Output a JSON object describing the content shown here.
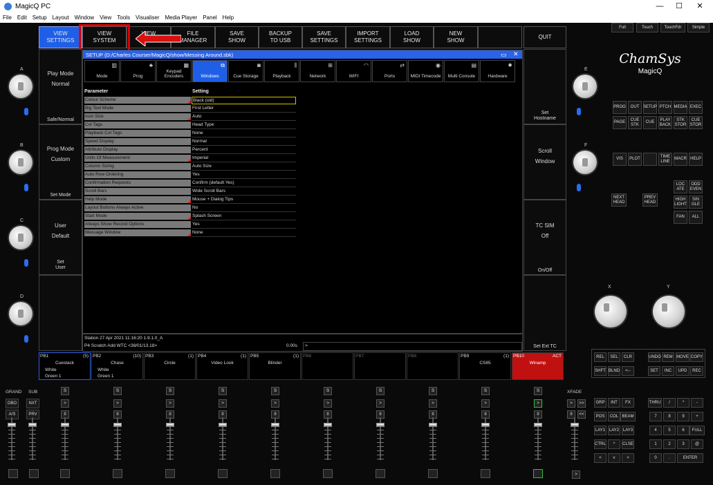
{
  "window": {
    "title": "MagicQ PC",
    "minimize": "—",
    "maximize": "☐",
    "close": "✕"
  },
  "menu": [
    "File",
    "Edit",
    "Setup",
    "Layout",
    "Window",
    "View",
    "Tools",
    "Visualiser",
    "Media Player",
    "Panel",
    "Help"
  ],
  "modes": [
    "Full",
    "Touch",
    "TouchFdr",
    "Simple"
  ],
  "top_buttons": [
    {
      "label": "VIEW\nSETTINGS",
      "active": true
    },
    {
      "label": "VIEW\nSYSTEM",
      "active": false
    },
    {
      "label": "VIEW\nD...",
      "active": false
    },
    {
      "label": "FILE\nMANAGER",
      "active": false
    },
    {
      "label": "SAVE\nSHOW",
      "active": false
    },
    {
      "label": "BACKUP\nTO USB",
      "active": false
    },
    {
      "label": "SAVE\nSETTINGS",
      "active": false
    },
    {
      "label": "IMPORT\nSETTINGS",
      "active": false
    },
    {
      "label": "LOAD\nSHOW",
      "active": false
    },
    {
      "label": "NEW\nSHOW",
      "active": false
    },
    {
      "label": "",
      "active": false
    },
    {
      "label": "QUIT",
      "active": false
    }
  ],
  "left_side": [
    {
      "title": "Play Mode",
      "value": "Normal",
      "sub": "Safe/Normal"
    },
    {
      "title": "Prog Mode",
      "value": "Custom",
      "sub": "Set Mode"
    },
    {
      "title": "User",
      "value": "Default",
      "sub": "Set\nUser"
    },
    {
      "title": "",
      "value": "",
      "sub": ""
    }
  ],
  "right_side": [
    {
      "title": "",
      "value": "",
      "sub": "Set\nHostname"
    },
    {
      "title": "Scroll",
      "value": "Window",
      "sub": ""
    },
    {
      "title": "TC SIM",
      "value": "Off",
      "sub": "On/Off"
    },
    {
      "title": "",
      "value": "",
      "sub": "Set Ext TC"
    }
  ],
  "encoders_left": [
    "A",
    "B",
    "C",
    "D"
  ],
  "encoders_right": [
    "E",
    "F"
  ],
  "xy": [
    "X",
    "Y"
  ],
  "setup": {
    "title": "SETUP (D:/Charles Courser/MagicQ/show/Messing Around.sbk)",
    "tabs": [
      "Mode",
      "Prog",
      "Keypad\nEncoders",
      "Windows",
      "Cue Storage",
      "Playback",
      "Network",
      "WIFI",
      "Ports",
      "MIDI Timecode",
      "Multi Console",
      "Hardware"
    ],
    "selected_tab": "Windows",
    "col_param": "Parameter",
    "col_setting": "Setting",
    "rows": [
      {
        "p": "Colour Scheme",
        "v": "Black (old)",
        "mark": true
      },
      {
        "p": "Big Text Mode",
        "v": "First Letter",
        "mark": false
      },
      {
        "p": "Icon Size",
        "v": "Auto",
        "mark": true
      },
      {
        "p": "Col Tags",
        "v": "Head Type",
        "mark": false
      },
      {
        "p": "Playback Col Tags",
        "v": "None",
        "mark": false
      },
      {
        "p": "Speed Display",
        "v": "Normal",
        "mark": false
      },
      {
        "p": "Attribute Display",
        "v": "Percent",
        "mark": false
      },
      {
        "p": "Units Of Measurement",
        "v": "Imperial",
        "mark": true
      },
      {
        "p": "Column Sizing",
        "v": "Auto Size",
        "mark": false
      },
      {
        "p": "Auto Row Ordering",
        "v": "Yes",
        "mark": false
      },
      {
        "p": "Confirmation Requests",
        "v": "Confirm (default Yes)",
        "mark": false
      },
      {
        "p": "Scroll Bars",
        "v": "Wide Scroll Bars",
        "mark": false
      },
      {
        "p": "Help Mode",
        "v": "Mouse + Dialog Tips",
        "mark": true
      },
      {
        "p": "Layout Buttons Always Active",
        "v": "No",
        "mark": false
      },
      {
        "p": "Start Mode",
        "v": "Splash Screen",
        "mark": true
      },
      {
        "p": "Always Show Record Options",
        "v": "Yes",
        "mark": false
      },
      {
        "p": "Message Window",
        "v": "None",
        "mark": true
      }
    ]
  },
  "status": {
    "line1": "Station 27 Apr 2021 11:16:20 1.9.1.0_A",
    "line2": "P4 Scratch   Add  WTC <38/01/13.18>",
    "time": "0.00s",
    "prompt": ">"
  },
  "playbacks": [
    {
      "n": "PB1",
      "c": "(5)",
      "name": "Cuestack",
      "l1": "White",
      "l2": "Green 1"
    },
    {
      "n": "PB2",
      "c": "(10)",
      "name": "Chase",
      "l1": "White",
      "l2": "Green 1"
    },
    {
      "n": "PB3",
      "c": "(1)",
      "name": "Circle",
      "l1": "",
      "l2": ""
    },
    {
      "n": "PB4",
      "c": "(1)",
      "name": "Video Look",
      "l1": "",
      "l2": ""
    },
    {
      "n": "PB5",
      "c": "(1)",
      "name": "Blinder",
      "l1": "",
      "l2": ""
    },
    {
      "n": "PB6",
      "c": "",
      "name": "",
      "l1": "",
      "l2": ""
    },
    {
      "n": "PB7",
      "c": "",
      "name": "",
      "l1": "",
      "l2": ""
    },
    {
      "n": "PB8",
      "c": "",
      "name": "",
      "l1": "",
      "l2": ""
    },
    {
      "n": "PB9",
      "c": "(1)",
      "name": "CS85",
      "l1": "",
      "l2": ""
    },
    {
      "n": "PB10",
      "c": "ACT",
      "name": "Winamp",
      "l1": "",
      "l2": ""
    }
  ],
  "grand": "GRAND",
  "sub": "SUB",
  "xfade": "XFADE",
  "grand_keys": [
    "DBO",
    "NXT",
    "A/S",
    "PRV"
  ],
  "brand": {
    "name": "ChamSys",
    "model": "MagicQ"
  },
  "hard_keys_1": [
    "PROG",
    "OUT",
    "SETUP",
    "PTCH",
    "MEDIA",
    "EXEC",
    "PAGE",
    "CUE\nSTK",
    "CUE",
    "PLAY\nBACK",
    "STK\nSTOR",
    "CUE\nSTOR"
  ],
  "hard_keys_2": [
    "VIS",
    "PLOT",
    "",
    "TIME\nLINE",
    "MACR",
    "HELP"
  ],
  "hard_keys_3": [
    "LOC\nATE",
    "ODD\nEVEN",
    "HIGH\nLIGHT",
    "SIN\nGLE",
    "FAN",
    "ALL"
  ],
  "next_head": "NEXT\nHEAD",
  "prev_head": "PREV\nHEAD",
  "rel_keys": [
    "REL",
    "SEL",
    "CLR",
    "UNDO",
    "REM",
    "MOVE",
    "COPY",
    "SHFT",
    "BLND",
    "<--",
    "SET",
    "INC",
    "UPD",
    "REC"
  ],
  "bottom_left_keys": [
    "GRP",
    "INT",
    "FX",
    "POS",
    "COL",
    "BEAM",
    "LAY1",
    "LAY2",
    "LAY3",
    "CTRL",
    "^",
    "CLSE",
    "<",
    "v",
    ">"
  ],
  "keypad": [
    "THRU",
    "/",
    "*",
    "-",
    "7",
    "8",
    "9",
    "+",
    "4",
    "5",
    "6",
    "FULL",
    "1",
    "2",
    "3",
    "@",
    "0",
    ".",
    "ENTER"
  ]
}
